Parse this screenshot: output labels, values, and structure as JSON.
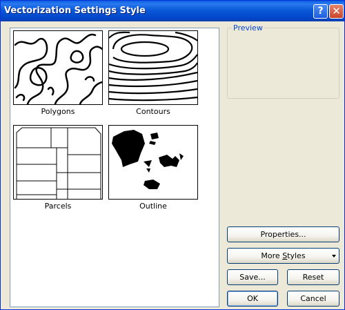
{
  "window": {
    "title": "Vectorization Settings Style"
  },
  "titlebar_buttons": {
    "help": "?",
    "close": "✕"
  },
  "styles": [
    {
      "label": "Polygons"
    },
    {
      "label": "Contours"
    },
    {
      "label": "Parcels"
    },
    {
      "label": "Outline"
    }
  ],
  "preview": {
    "label": "Preview"
  },
  "buttons": {
    "properties": "Properties...",
    "more_styles_pre": "More ",
    "more_styles_mnemonic": "S",
    "more_styles_post": "tyles",
    "save": "Save...",
    "reset": "Reset",
    "ok": "OK",
    "cancel": "Cancel"
  }
}
